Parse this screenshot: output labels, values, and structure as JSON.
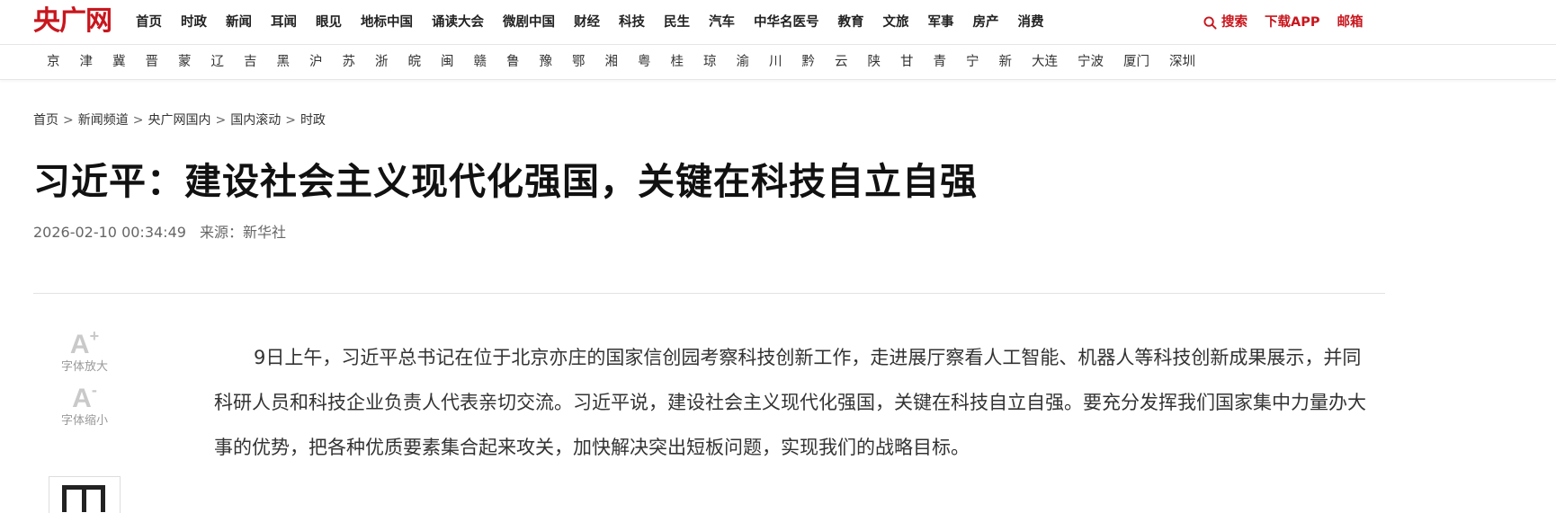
{
  "brand": {
    "logo_text": "央广网",
    "accent_color": "#c8161d"
  },
  "nav": {
    "items": [
      "首页",
      "时政",
      "新闻",
      "耳闻",
      "眼见",
      "地标中国",
      "诵读大会",
      "微剧中国",
      "财经",
      "科技",
      "民生",
      "汽车",
      "中华名医号",
      "教育",
      "文旅",
      "军事",
      "房产",
      "消费"
    ]
  },
  "tools_bar": {
    "search_label": "搜索",
    "app_label": "下载APP",
    "mail_label": "邮箱",
    "search_icon": "search-icon"
  },
  "regions": {
    "items": [
      "京",
      "津",
      "冀",
      "晋",
      "蒙",
      "辽",
      "吉",
      "黑",
      "沪",
      "苏",
      "浙",
      "皖",
      "闽",
      "赣",
      "鲁",
      "豫",
      "鄂",
      "湘",
      "粤",
      "桂",
      "琼",
      "渝",
      "川",
      "黔",
      "云",
      "陕",
      "甘",
      "青",
      "宁",
      "新",
      "大连",
      "宁波",
      "厦门",
      "深圳"
    ]
  },
  "breadcrumb": {
    "items": [
      "首页",
      "新闻频道",
      "央广网国内",
      "国内滚动",
      "时政"
    ],
    "separator": ">"
  },
  "article": {
    "title": "习近平：建设社会主义现代化强国，关键在科技自立自强",
    "datetime": "2026-02-10 00:34:49",
    "source_label": "来源：",
    "source": "新华社",
    "body": "9日上午，习近平总书记在位于北京亦庄的国家信创园考察科技创新工作，走进展厅察看人工智能、机器人等科技创新成果展示，并同科研人员和科技企业负责人代表亲切交流。习近平说，建设社会主义现代化强国，关键在科技自立自强。要充分发挥我们国家集中力量办大事的优势，把各种优质要素集合起来攻关，加快解决突出短板问题，实现我们的战略目标。"
  },
  "font_tools": {
    "increase_glyph": "A",
    "increase_sup": "+",
    "increase_label": "字体放大",
    "decrease_glyph": "A",
    "decrease_sup": "-",
    "decrease_label": "字体缩小"
  }
}
